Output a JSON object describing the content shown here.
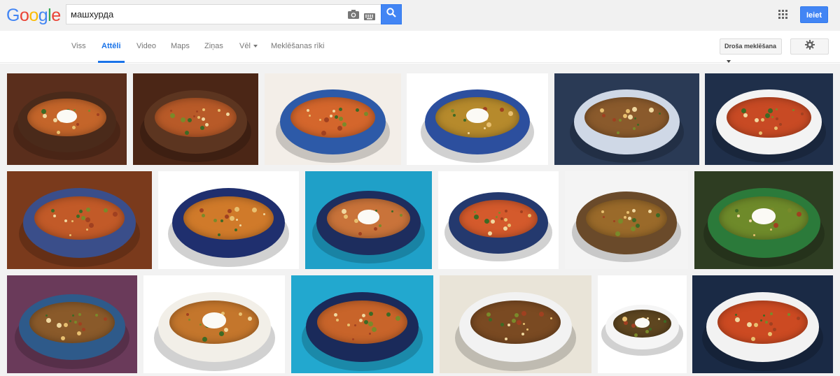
{
  "logo": {
    "letters": [
      "G",
      "o",
      "o",
      "g",
      "l",
      "e"
    ],
    "colors": [
      "#4285f4",
      "#ea4335",
      "#fbbc05",
      "#4285f4",
      "#34a853",
      "#ea4335"
    ]
  },
  "search": {
    "query": "машхурда",
    "camera_icon": "camera-icon",
    "keyboard_icon": "keyboard-icon",
    "search_icon": "search-icon"
  },
  "header": {
    "apps_icon": "apps-grid-icon",
    "signin_label": "Ieiet",
    "accent": "#4285f4"
  },
  "tabs": [
    {
      "label": "Viss",
      "active": false
    },
    {
      "label": "Attēli",
      "active": true
    },
    {
      "label": "Video",
      "active": false
    },
    {
      "label": "Maps",
      "active": false
    },
    {
      "label": "Ziņas",
      "active": false
    },
    {
      "label": "Vēl",
      "active": false,
      "dropdown": true
    },
    {
      "label": "Meklēšanas rīki",
      "active": false
    }
  ],
  "toolbar": {
    "safesearch_label": "Droša meklēšana",
    "settings_icon": "gear-icon"
  },
  "images": {
    "rows": [
      [
        {
          "alt": "soup-1",
          "bg": "#5a2e1c",
          "bowl": "#4a2a1a",
          "soup": "#c4652a"
        },
        {
          "alt": "soup-2",
          "bg": "#4b2616",
          "bowl": "#5c3520",
          "soup": "#b85a28"
        },
        {
          "alt": "soup-3",
          "bg": "#f3eee8",
          "bowl": "#2d5aa8",
          "soup": "#d4662c"
        },
        {
          "alt": "soup-4",
          "bg": "#ffffff",
          "bowl": "#2c4f9e",
          "soup": "#b68a2c"
        },
        {
          "alt": "soup-5",
          "bg": "#2a3a55",
          "bowl": "#cfd8e6",
          "soup": "#8a5a2c"
        },
        {
          "alt": "soup-6",
          "bg": "#1f2f4a",
          "bowl": "#f3f3f3",
          "soup": "#c84a24"
        }
      ],
      [
        {
          "alt": "soup-7",
          "bg": "#7a3a1c",
          "bowl": "#3a4e8a",
          "soup": "#c25a28"
        },
        {
          "alt": "soup-8",
          "bg": "#ffffff",
          "bowl": "#1f2f6e",
          "soup": "#d07a2a"
        },
        {
          "alt": "soup-9",
          "bg": "#1fa0c8",
          "bowl": "#1d2d5e",
          "soup": "#c9733a"
        },
        {
          "alt": "soup-10",
          "bg": "#ffffff",
          "bowl": "#24396e",
          "soup": "#d45a2c"
        },
        {
          "alt": "soup-11",
          "bg": "#f4f4f4",
          "bowl": "#6a4a2a",
          "soup": "#9a6a2a"
        },
        {
          "alt": "soup-12",
          "bg": "#2e3d22",
          "bowl": "#2b7a3a",
          "soup": "#6e8a2a"
        }
      ],
      [
        {
          "alt": "soup-13",
          "bg": "#6a3a5a",
          "bowl": "#2e5a8a",
          "soup": "#8a5a2a"
        },
        {
          "alt": "soup-14",
          "bg": "#ffffff",
          "bowl": "#f2efe8",
          "soup": "#c4762c"
        },
        {
          "alt": "soup-15",
          "bg": "#22a8cf",
          "bowl": "#1a2a5a",
          "soup": "#c8642a"
        },
        {
          "alt": "soup-16",
          "bg": "#e9e4d8",
          "bowl": "#f2f2f2",
          "soup": "#7a4a22"
        },
        {
          "alt": "soup-17",
          "bg": "#ffffff",
          "bowl": "#f5f5f5",
          "soup": "#5e4620"
        },
        {
          "alt": "soup-18",
          "bg": "#1a2a45",
          "bowl": "#f2f2f2",
          "soup": "#cc4a22"
        }
      ]
    ]
  }
}
